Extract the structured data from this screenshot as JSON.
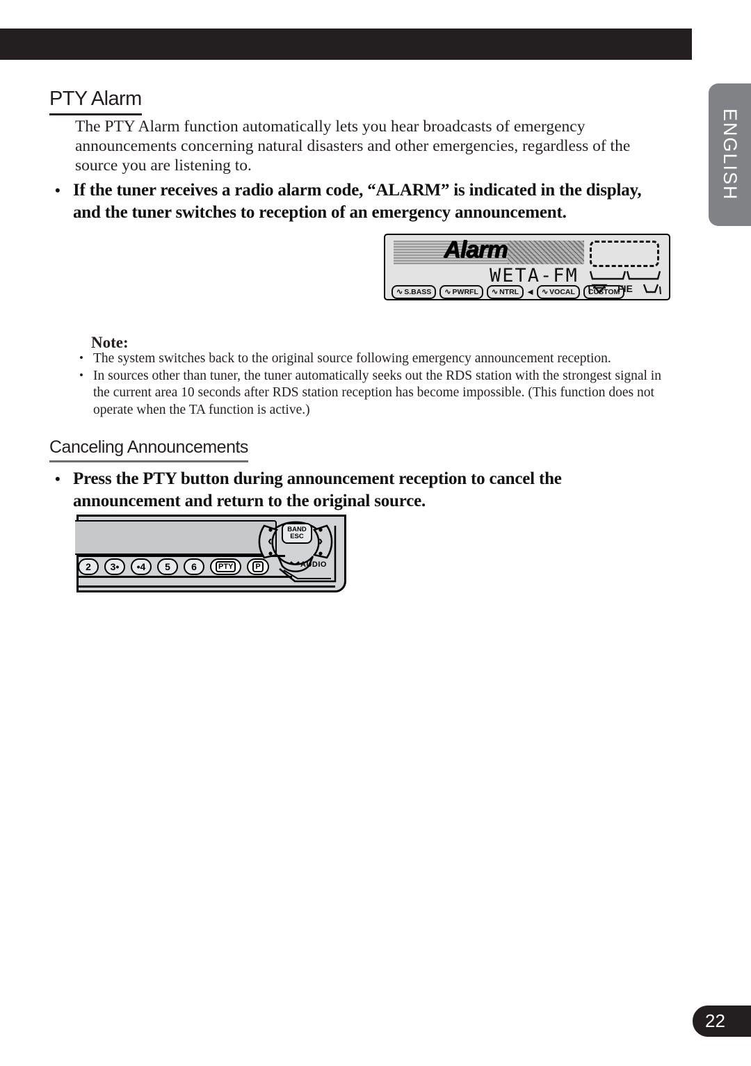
{
  "page": {
    "number": "22",
    "language_tab": "ENGLISH"
  },
  "sections": [
    {
      "heading": "PTY Alarm",
      "body": "The PTY Alarm function automatically lets you hear broadcasts of emergency announcements concerning natural disasters and other emergencies, regardless of the source you are listening to.",
      "bold_bullet": "If the tuner receives a radio alarm code, “ALARM” is indicated in the display, and the tuner switches to reception of an emergency announcement.",
      "bullet_mark": "•"
    },
    {
      "heading": "Canceling Announcements",
      "bold_bullet": "Press the PTY button during announcement reception to cancel the announcement and return to the original source.",
      "bullet_mark": "•"
    }
  ],
  "note": {
    "title": "Note:",
    "bullet_mark": "•",
    "items": [
      "The system switches back to the original source following emergency announcement reception.",
      "In sources other than tuner, the tuner automatically seeks out the RDS station with the strongest signal in the current area 10 seconds after RDS station reception has become impossible. (This function does not operate when the TA function is active.)"
    ]
  },
  "display_illustration": {
    "alarm_text": "Alarm",
    "station_text": "WETA-FM",
    "eq_chips": [
      {
        "label": "S.BASS",
        "wave": "∿"
      },
      {
        "label": "PWRFL",
        "wave": "∿"
      },
      {
        "label": "NTRL",
        "wave": "∿"
      },
      {
        "label": "VOCAL",
        "wave": "∿"
      },
      {
        "label": "CUSTOM",
        "wave": ""
      }
    ],
    "arrow_mark": "◄",
    "fie_label": "FIE",
    "speaker_icon": "speaker-icon",
    "sub_icon": "subwoofer-icon"
  },
  "panel_illustration": {
    "buttons": [
      {
        "label": "2"
      },
      {
        "label": "3•"
      },
      {
        "label": "•4"
      },
      {
        "label": "5"
      },
      {
        "label": "6"
      },
      {
        "label": "PTY",
        "highlight": true
      },
      {
        "label": "P"
      }
    ],
    "band_label": "BAND",
    "esc_label": "ESC",
    "audio_label": "AUDIO",
    "left_arrow": "‹",
    "right_arrow": "›"
  }
}
